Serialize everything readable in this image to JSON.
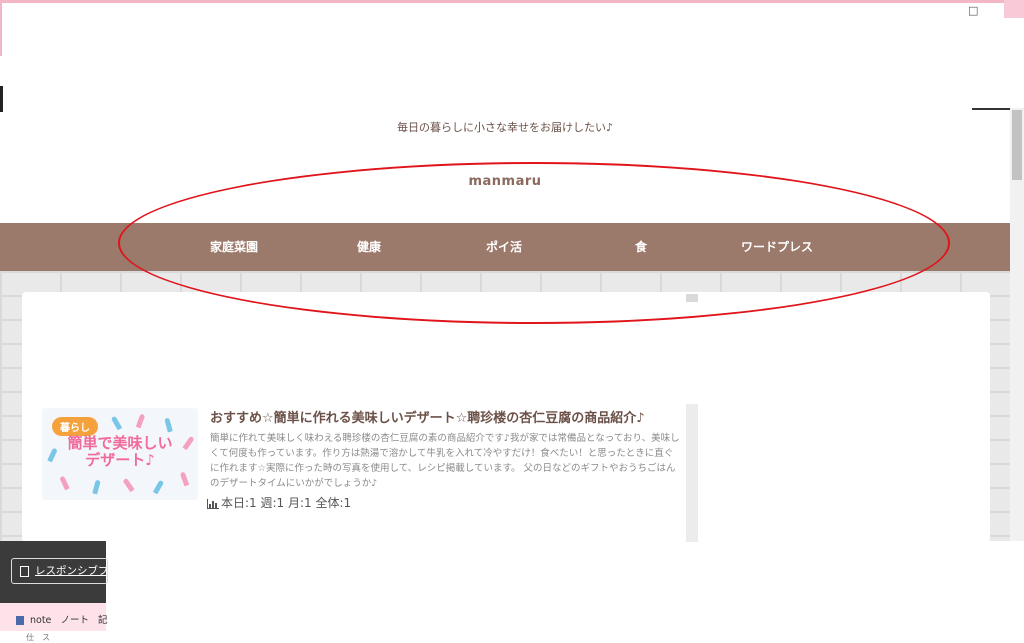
{
  "window": {
    "control_glyph": "□"
  },
  "header": {
    "tagline": "毎日の暮らしに小さな幸せをお届けしたい♪",
    "site_title": "manmaru"
  },
  "nav": {
    "items": [
      "家庭菜園",
      "健康",
      "ポイ活",
      "食",
      "ワードプレス"
    ]
  },
  "article": {
    "category_tag": "暮らし",
    "thumb_line1": "簡単で美味しい",
    "thumb_line2": "デザート♪",
    "title": "おすすめ☆簡単に作れる美味しいデザート☆聘珍楼の杏仁豆腐の商品紹介♪",
    "excerpt": "簡単に作れて美味しく味わえる聘珍楼の杏仁豆腐の素の商品紹介です♪我が家では常備品となっており、美味しくて何度も作っています。作り方は熱湯で溶かして牛乳を入れて冷やすだけ！食べたい！と思ったときに直ぐに作れます☆実際に作った時の写真を使用して、レシピ掲載しています。 父の日などのギフトやおうちごはんのデザートタイムにいかがでしょうか♪",
    "stats": "本日:1 週:1 月:1 全体:1"
  },
  "taskbar": {
    "responsive_button": "レスポンシブプ",
    "tab_items": [
      "note",
      "ノート",
      "記"
    ],
    "bottom_text": "仕",
    "bottom_text2": "ス"
  },
  "colors": {
    "nav_bg": "#9c7a6b",
    "title_brown": "#6b5148",
    "annotation_red": "#e0141a",
    "frame_pink": "#f3b6c6"
  }
}
